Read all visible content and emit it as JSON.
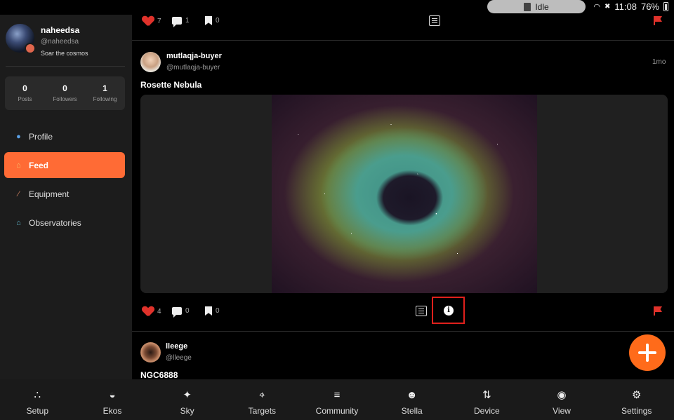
{
  "status": {
    "pill_text": "Idle",
    "time": "11:08",
    "battery": "76%"
  },
  "profile": {
    "name": "naheedsa",
    "handle": "@naheedsa",
    "bio": "Soar the cosmos"
  },
  "stats": [
    {
      "value": "0",
      "label": "Posts"
    },
    {
      "value": "0",
      "label": "Followers"
    },
    {
      "value": "1",
      "label": "Following"
    }
  ],
  "nav": [
    {
      "label": "Profile",
      "icon": "person-icon"
    },
    {
      "label": "Feed",
      "icon": "home-icon",
      "active": true
    },
    {
      "label": "Equipment",
      "icon": "telescope-icon"
    },
    {
      "label": "Observatories",
      "icon": "observatory-icon"
    }
  ],
  "prev_post": {
    "likes": "7",
    "comments": "1",
    "bookmarks": "0"
  },
  "post1": {
    "user": "mutlaqja-buyer",
    "handle": "@mutlaqja-buyer",
    "time": "1mo",
    "title": "Rosette Nebula",
    "likes": "4",
    "comments": "0",
    "bookmarks": "0"
  },
  "post2": {
    "user": "lleege",
    "handle": "@lleege",
    "title": "NGC6888"
  },
  "bottom_nav": [
    {
      "label": "Setup",
      "icon": "share-nodes-icon"
    },
    {
      "label": "Ekos",
      "icon": "dome-icon"
    },
    {
      "label": "Sky",
      "icon": "sparkle-icon"
    },
    {
      "label": "Targets",
      "icon": "crosshair-icon"
    },
    {
      "label": "Community",
      "icon": "people-icon"
    },
    {
      "label": "Stella",
      "icon": "ai-head-icon"
    },
    {
      "label": "Device",
      "icon": "arrows-updown-icon"
    },
    {
      "label": "View",
      "icon": "eye-icon"
    },
    {
      "label": "Settings",
      "icon": "gear-icon"
    }
  ],
  "colors": {
    "accent": "#ff6b35",
    "like": "#e0322b",
    "highlight_box": "#e0201c"
  }
}
